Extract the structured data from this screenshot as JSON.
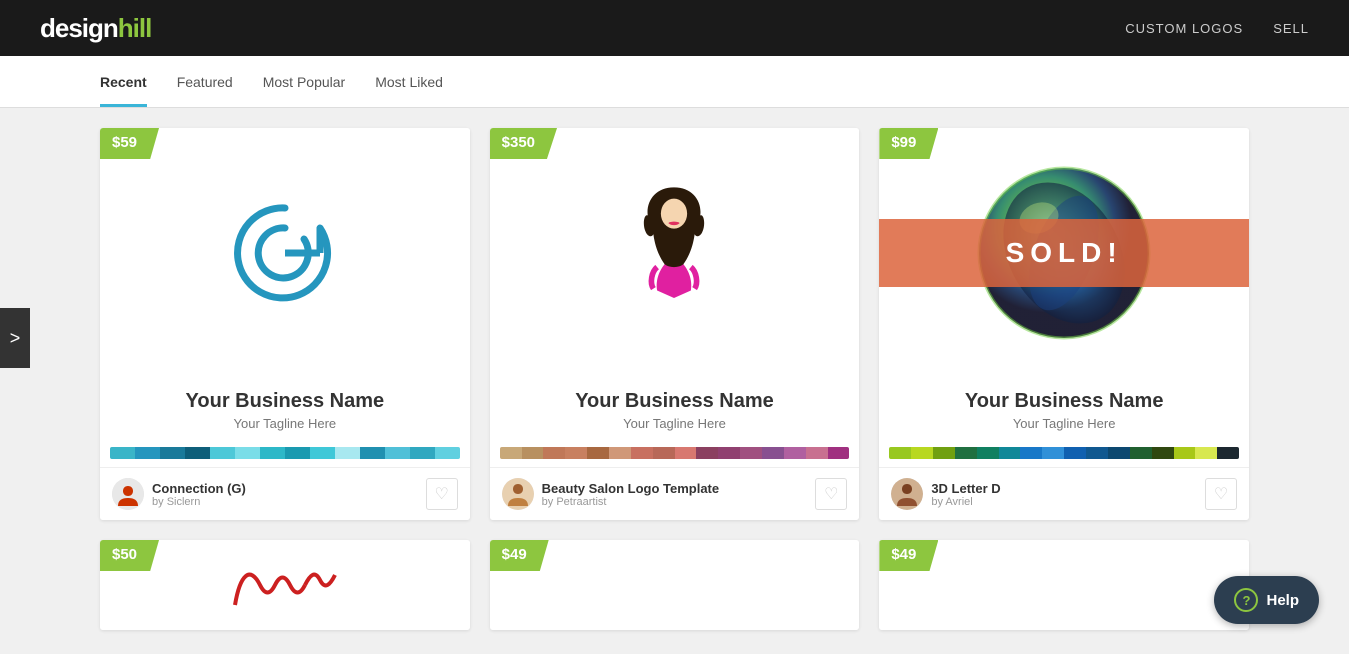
{
  "header": {
    "logo_design": "design",
    "logo_hill": "hill",
    "nav": [
      {
        "label": "CUSTOM LOGOS",
        "id": "custom-logos"
      },
      {
        "label": "SELL",
        "id": "sell"
      }
    ]
  },
  "tabs": [
    {
      "label": "Recent",
      "active": true,
      "id": "recent"
    },
    {
      "label": "Featured",
      "active": false,
      "id": "featured"
    },
    {
      "label": "Most Popular",
      "active": false,
      "id": "most-popular"
    },
    {
      "label": "Most Liked",
      "active": false,
      "id": "most-liked"
    }
  ],
  "arrow": {
    "label": ">"
  },
  "cards": [
    {
      "price": "$59",
      "business_name": "Your Business Name",
      "tagline": "Your Tagline Here",
      "title": "Connection (G)",
      "author": "Siclern",
      "palette": [
        "#3ab5c8",
        "#2596be",
        "#1a7a9a",
        "#0e5f7a",
        "#4dc8d8",
        "#7adde8",
        "#2db8c8",
        "#1a9ab0",
        "#3fc8d8",
        "#a8e8f0",
        "#2090b0",
        "#50c0d8",
        "#30a8c0",
        "#60d0e0"
      ]
    },
    {
      "price": "$350",
      "business_name": "Your Business Name",
      "tagline": "Your Tagline Here",
      "title": "Beauty Salon Logo Template",
      "author": "Petraartist",
      "palette": [
        "#c8a878",
        "#b89060",
        "#c07858",
        "#c88060",
        "#a86840",
        "#d09878",
        "#c87060",
        "#b86858",
        "#d87870",
        "#8b4060",
        "#904070",
        "#a05080",
        "#885090",
        "#b060a0",
        "#c87090",
        "#a03080"
      ]
    },
    {
      "price": "$99",
      "sold": true,
      "sold_label": "SOLD!",
      "business_name": "Your Business Name",
      "tagline": "Your Tagline Here",
      "title": "3D Letter D",
      "author": "Avriel",
      "palette": [
        "#98c820",
        "#b8d820",
        "#70a010",
        "#207040",
        "#108060",
        "#108898",
        "#1878c8",
        "#3090d8",
        "#1060b0",
        "#105890",
        "#0c4870",
        "#206030",
        "#304810",
        "#a8c818",
        "#d8e850",
        "#1c2830"
      ]
    }
  ],
  "partial_cards": [
    {
      "price": "$50"
    },
    {
      "price": "$49"
    },
    {
      "price": "$49"
    }
  ],
  "help": {
    "label": "Help"
  }
}
